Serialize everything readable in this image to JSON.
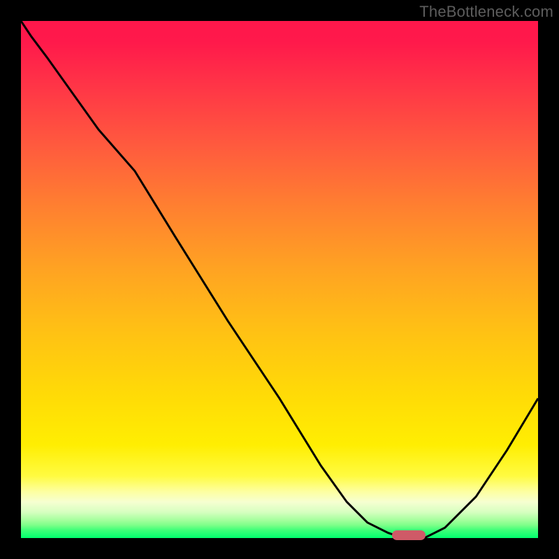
{
  "watermark": "TheBottleneck.com",
  "chart_data": {
    "type": "line",
    "title": "",
    "xlabel": "",
    "ylabel": "",
    "x": [
      0.0,
      0.02,
      0.05,
      0.1,
      0.15,
      0.22,
      0.3,
      0.4,
      0.5,
      0.58,
      0.63,
      0.67,
      0.71,
      0.74,
      0.78,
      0.82,
      0.88,
      0.94,
      1.0
    ],
    "values": [
      1.0,
      0.97,
      0.93,
      0.86,
      0.79,
      0.71,
      0.58,
      0.42,
      0.27,
      0.14,
      0.07,
      0.03,
      0.01,
      0.0,
      0.0,
      0.02,
      0.08,
      0.17,
      0.27
    ],
    "xlim": [
      0,
      1
    ],
    "ylim": [
      0,
      1
    ],
    "marker": {
      "x": 0.75,
      "y": 0.005
    },
    "background_gradient": {
      "top": "#ff174b",
      "mid": "#ffda07",
      "bottom": "#00ff6e"
    }
  },
  "colors": {
    "frame": "#000000",
    "curve": "#000000",
    "marker": "#cf5a67",
    "watermark": "#5d5d5d"
  }
}
